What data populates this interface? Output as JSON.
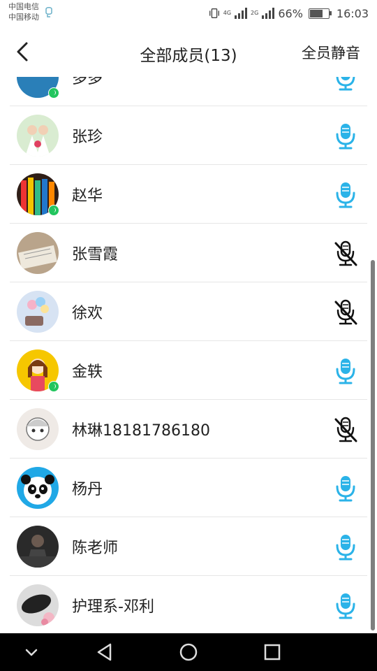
{
  "status": {
    "carrier1": "中国电信",
    "carrier2": "中国移动",
    "net1": "4G",
    "net2": "2G",
    "battery_percent": "66%",
    "battery_level": 0.66,
    "time": "16:03"
  },
  "header": {
    "back_icon": "chevron-left-icon",
    "title": "全部成员(13)",
    "mute_all": "全员静音"
  },
  "colors": {
    "mic_active": "#2bb3e8",
    "mic_muted": "#111111",
    "speaking_badge": "#22c55e"
  },
  "members": [
    {
      "name": "多多",
      "mic": "on",
      "speaking": true
    },
    {
      "name": "张珍",
      "mic": "on",
      "speaking": false
    },
    {
      "name": "赵华",
      "mic": "on",
      "speaking": true
    },
    {
      "name": "张雪霞",
      "mic": "off",
      "speaking": false
    },
    {
      "name": "徐欢",
      "mic": "off",
      "speaking": false
    },
    {
      "name": "金轶",
      "mic": "on",
      "speaking": true
    },
    {
      "name": "林琳18181786180",
      "mic": "off",
      "speaking": false
    },
    {
      "name": "杨丹",
      "mic": "on",
      "speaking": false
    },
    {
      "name": "陈老师",
      "mic": "on",
      "speaking": false
    },
    {
      "name": "护理系-邓利",
      "mic": "on",
      "speaking": false
    }
  ],
  "navbar": {
    "hide": "chevron-down-icon",
    "back": "triangle-back-icon",
    "home": "circle-home-icon",
    "recents": "square-recents-icon"
  }
}
